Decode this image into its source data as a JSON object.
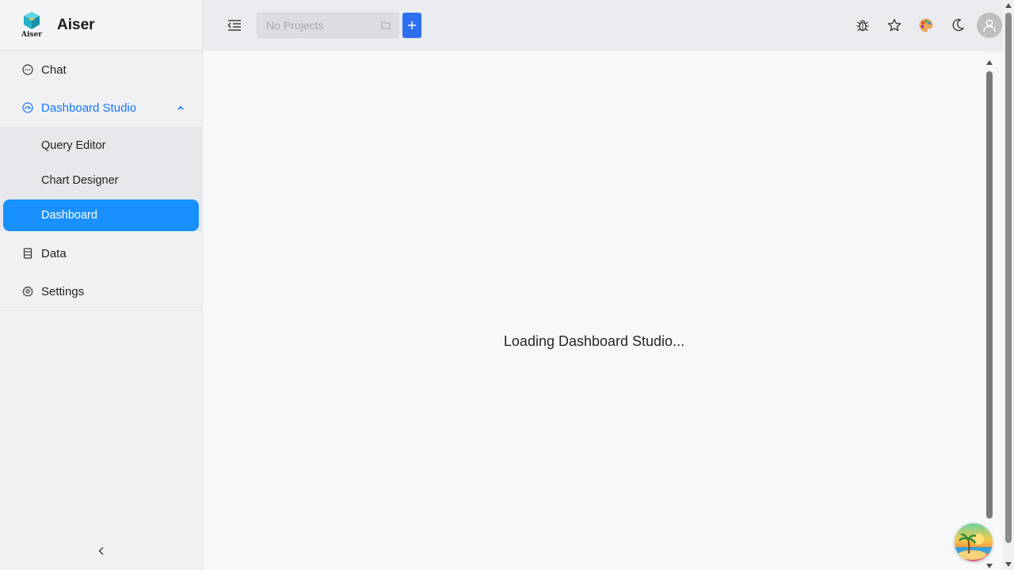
{
  "app": {
    "name": "Aiser",
    "logo_text": "Aiser"
  },
  "sidebar": {
    "items": [
      {
        "label": "Chat",
        "icon": "chat-bubble-icon"
      },
      {
        "label": "Dashboard Studio",
        "icon": "dashboard-gauge-icon",
        "expanded": true,
        "children": [
          {
            "label": "Query Editor"
          },
          {
            "label": "Chart Designer"
          },
          {
            "label": "Dashboard",
            "active": true
          }
        ]
      },
      {
        "label": "Data",
        "icon": "database-icon"
      },
      {
        "label": "Settings",
        "icon": "gear-icon"
      }
    ],
    "collapse_icon": "chevron-left-icon"
  },
  "header": {
    "project_select": {
      "placeholder": "No Projects",
      "icon": "folder-icon"
    },
    "add_button_icon": "plus-icon",
    "right_icons": [
      "bug-icon",
      "star-icon",
      "palette-icon",
      "moon-icon",
      "user-avatar-icon"
    ]
  },
  "main": {
    "loading_text": "Loading Dashboard Studio..."
  },
  "colors": {
    "accent": "#1677ff",
    "active_bg": "#1890ff",
    "add_button": "#2d6ff0",
    "sidebar_bg": "#f0f1f3",
    "header_bg": "#eaebee",
    "content_bg": "#f7f8fa"
  }
}
